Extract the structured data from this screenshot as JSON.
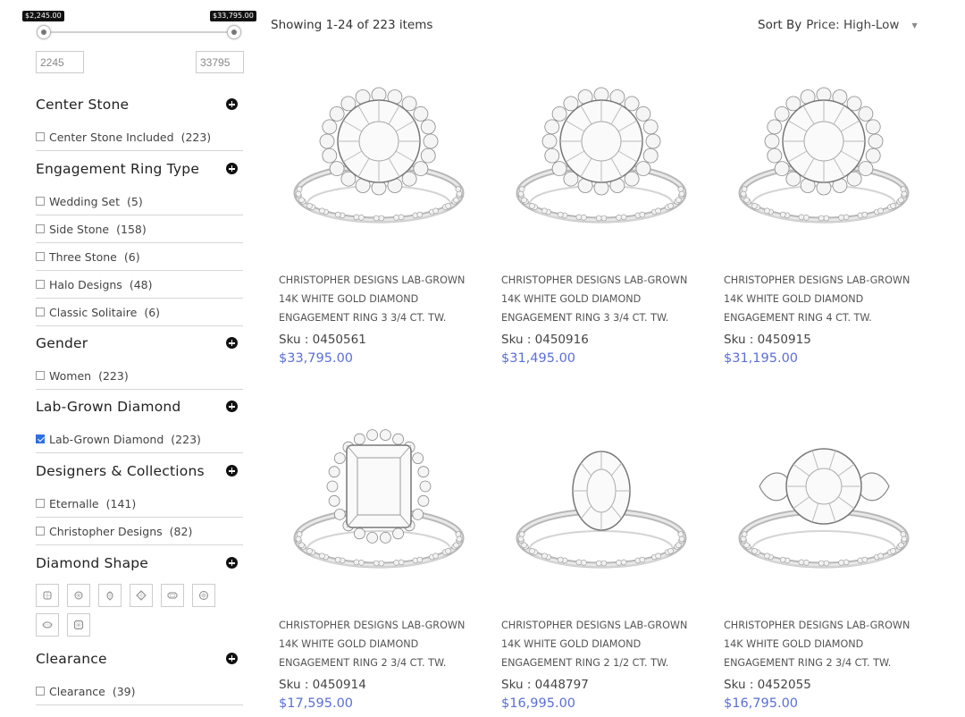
{
  "price_filter": {
    "min_tip": "$2,245.00",
    "max_tip": "$33,795.00",
    "min_value": "2245",
    "max_value": "33795"
  },
  "filters": {
    "center_stone": {
      "title": "Center Stone",
      "options": [
        {
          "label": "Center Stone Included",
          "count": "(223)"
        }
      ]
    },
    "ring_type": {
      "title": "Engagement Ring Type",
      "options": [
        {
          "label": "Wedding Set",
          "count": "(5)"
        },
        {
          "label": "Side Stone",
          "count": "(158)"
        },
        {
          "label": "Three Stone",
          "count": "(6)"
        },
        {
          "label": "Halo Designs",
          "count": "(48)"
        },
        {
          "label": "Classic Solitaire",
          "count": "(6)"
        }
      ]
    },
    "gender": {
      "title": "Gender",
      "options": [
        {
          "label": "Women",
          "count": "(223)"
        }
      ]
    },
    "lab_grown": {
      "title": "Lab-Grown Diamond",
      "options": [
        {
          "label": "Lab-Grown Diamond",
          "count": "(223)",
          "checked": true
        }
      ]
    },
    "designers": {
      "title": "Designers & Collections",
      "options": [
        {
          "label": "Eternalle",
          "count": "(141)"
        },
        {
          "label": "Christopher Designs",
          "count": "(82)"
        }
      ]
    },
    "diamond_shape": {
      "title": "Diamond Shape",
      "shapes": [
        "cushion-shape-icon",
        "round-shape-icon",
        "pear-shape-icon",
        "princess-shape-icon",
        "emerald-shape-icon",
        "oval-shape-icon",
        "marquise-shape-icon",
        "radiant-shape-icon"
      ]
    },
    "clearance": {
      "title": "Clearance",
      "options": [
        {
          "label": "Clearance",
          "count": "(39)"
        }
      ]
    }
  },
  "results": {
    "showing": "Showing 1-24 of 223 items",
    "sort_label": "Sort By",
    "sort_value": "Price: High-Low"
  },
  "products": [
    {
      "name": "Christopher Designs Lab-Grown 14K White Gold Diamond Engagement Ring 3 3/4 ct. tw.",
      "sku": "Sku : 0450561",
      "price": "$33,795.00",
      "style": "round-halo-split"
    },
    {
      "name": "Christopher Designs Lab-Grown 14K White Gold Diamond Engagement Ring 3 3/4 ct. tw.",
      "sku": "Sku : 0450916",
      "price": "$31,495.00",
      "style": "round-halo-twist"
    },
    {
      "name": "Christopher Designs Lab-Grown 14K White Gold Diamond Engagement Ring 4 ct. tw.",
      "sku": "Sku : 0450915",
      "price": "$31,195.00",
      "style": "round-halo-split"
    },
    {
      "name": "Christopher Designs Lab-Grown 14K White Gold Diamond Engagement Ring 2 3/4 ct. tw.",
      "sku": "Sku : 0450914",
      "price": "$17,595.00",
      "style": "emerald-halo"
    },
    {
      "name": "Christopher Designs Lab-Grown 14K White Gold Diamond Engagement Ring 2 1/2 ct. tw.",
      "sku": "Sku : 0448797",
      "price": "$16,995.00",
      "style": "oval-solitaire"
    },
    {
      "name": "Christopher Designs Lab-Grown 14K White Gold Diamond Engagement Ring 2 3/4 ct. tw.",
      "sku": "Sku : 0452055",
      "price": "$16,795.00",
      "style": "three-stone"
    }
  ],
  "colors": {
    "price": "#5a6fd8",
    "checkbox_checked": "#2f6fe0"
  }
}
